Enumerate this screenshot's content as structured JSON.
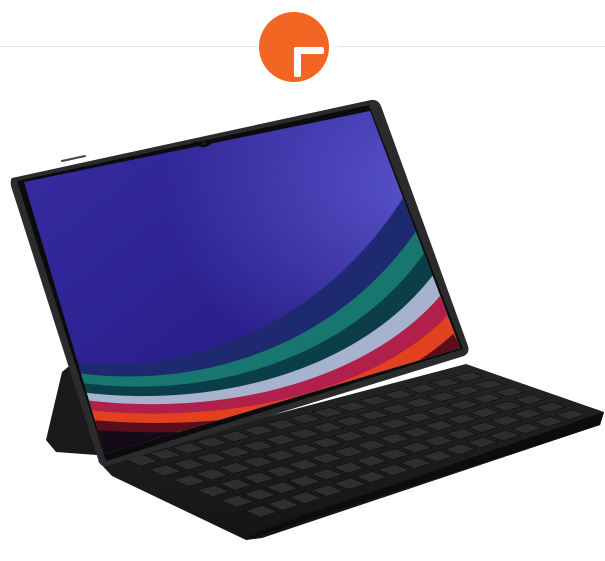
{
  "colors": {
    "accent": "#f26522",
    "background": "#ffffff",
    "divider": "#e2e2e2",
    "device_frame": "#2b2b2d",
    "keyboard_cover": "#1c1c1e"
  },
  "add_button": {
    "icon": "plus-icon"
  },
  "product_image": {
    "icon": "tablet-with-keyboard-cover-image"
  }
}
